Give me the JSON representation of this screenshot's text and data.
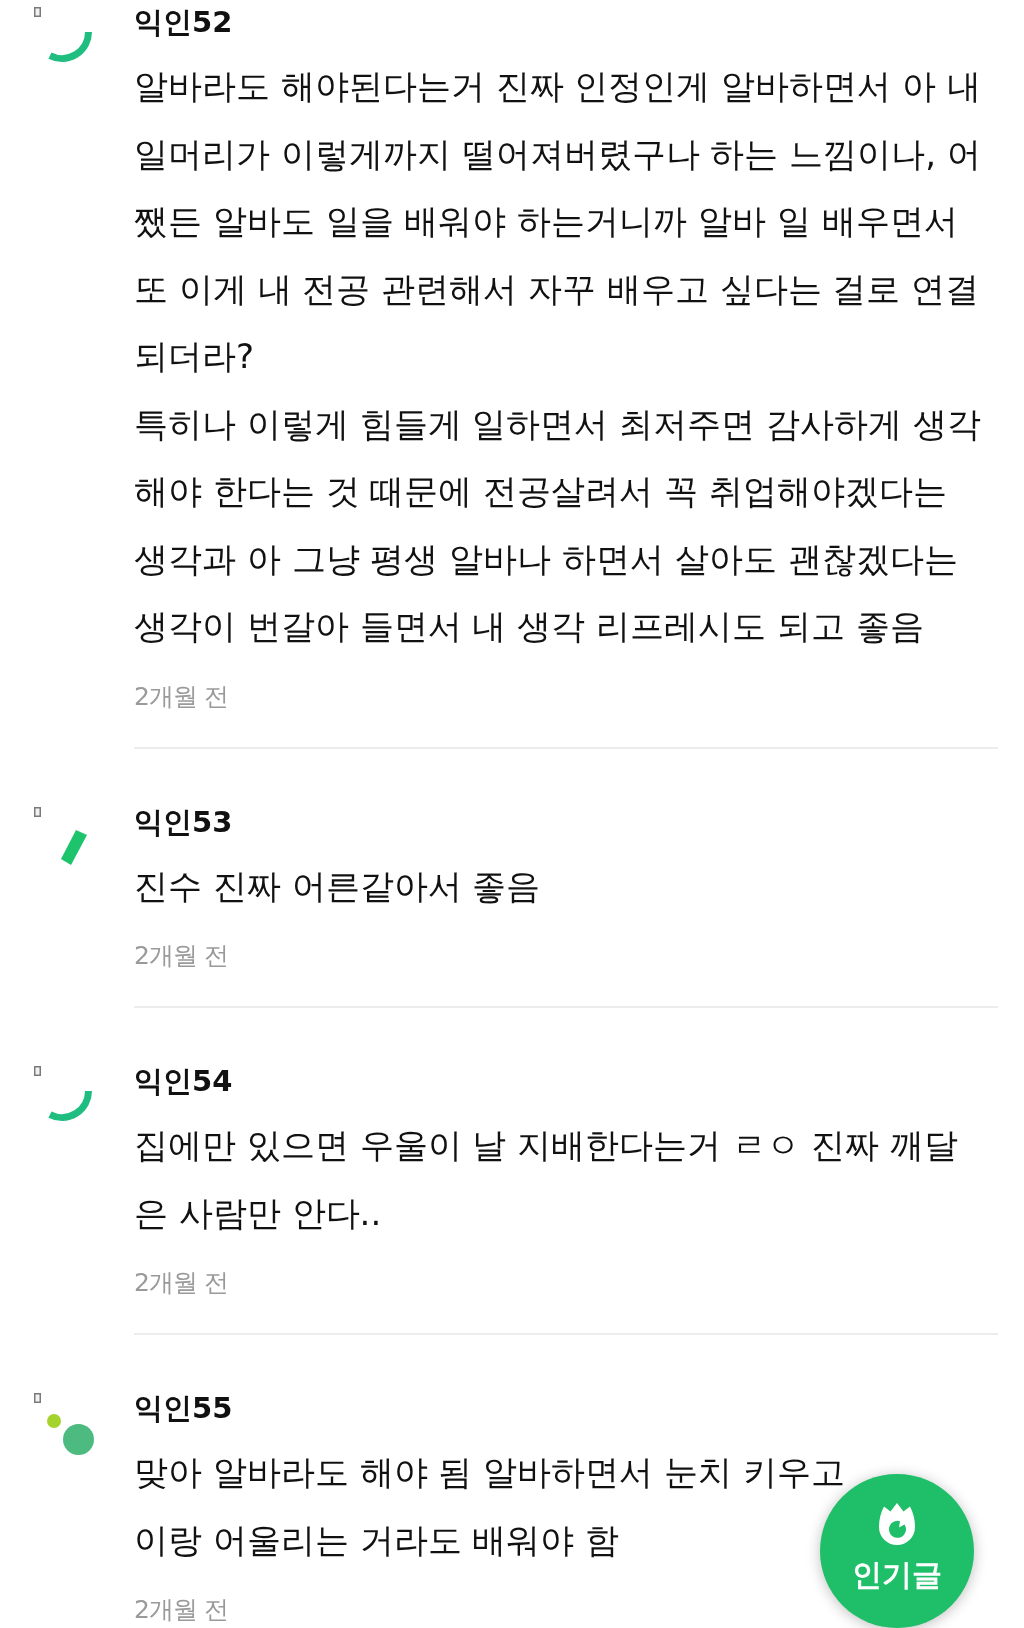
{
  "comments": [
    {
      "author": "익인52",
      "avatar": {
        "kind": "arc"
      },
      "paragraphs": [
        "알바라도 해야된다는거 진짜 인정인게 알바하면서 아 내 일머리가 이렇게까지 떨어져버렸구나 하는 느낌이나, 어쨌든 알바도 일을 배워야 하는거니까 알바 일 배우면서 또 이게 내 전공 관련해서 자꾸 배우고 싶다는 걸로 연결되더라?",
        "특히나 이렇게 힘들게 일하면서 최저주면 감사하게 생각해야 한다는 것 때문에 전공살려서 꼭 취업해야겠다는 생각과 아 그냥 평생 알바나 하면서 살아도 괜찮겠다는 생각이 번갈아 들면서 내 생각 리프레시도 되고 좋음"
      ],
      "time": "2개월 전"
    },
    {
      "author": "익인53",
      "avatar": {
        "kind": "slash"
      },
      "paragraphs": [
        "진수 진짜 어른같아서 좋음"
      ],
      "time": "2개월 전"
    },
    {
      "author": "익인54",
      "avatar": {
        "kind": "arc"
      },
      "paragraphs": [
        "집에만 있으면 우울이 날 지배한다는거 ㄹㅇ 진짜 깨달은 사람만 안다.."
      ],
      "time": "2개월 전"
    },
    {
      "author": "익인55",
      "avatar": {
        "kind": "dots"
      },
      "paragraphs": [
        "맞아 알바라도 해야 됨 알바하면서 눈치 키우고",
        "이랑 어울리는 거라도 배워야 함"
      ],
      "time": "2개월 전"
    }
  ],
  "floating_button": {
    "label": "인기글"
  }
}
